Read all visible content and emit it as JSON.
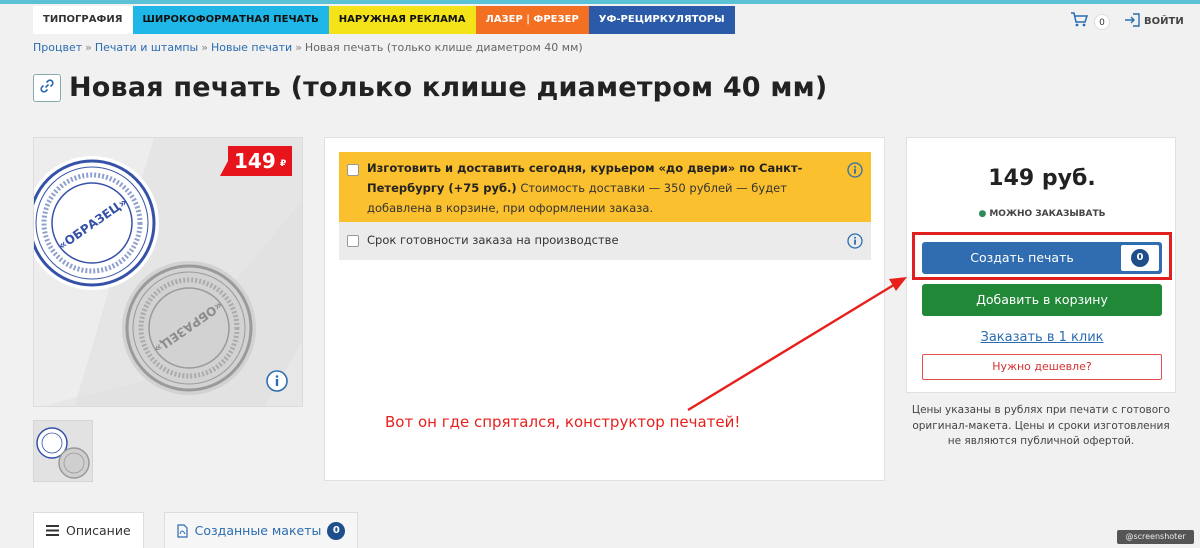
{
  "nav": {
    "tabs": [
      {
        "label": "ТИПОГРАФИЯ",
        "color": "#ffffff"
      },
      {
        "label": "ШИРОКОФОРМАТНАЯ ПЕЧАТЬ",
        "color": "#1fb6e8"
      },
      {
        "label": "НАРУЖНАЯ РЕКЛАМА",
        "color": "#f5e31a"
      },
      {
        "label": "ЛАЗЕР | ФРЕЗЕР",
        "color": "#f36f21"
      },
      {
        "label": "УФ-РЕЦИРКУЛЯТОРЫ",
        "color": "#2a5aa8"
      }
    ],
    "cart_count": "0",
    "login_label": "ВОЙТИ"
  },
  "breadcrumb": {
    "items": [
      "Процвет",
      "Печати и штампы",
      "Новые печати"
    ],
    "separator": "»",
    "current": "Новая печать (только клише диаметром 40 мм)"
  },
  "page": {
    "title": "Новая печать (только клише диаметром 40 мм)"
  },
  "product": {
    "price_badge": "149",
    "currency_symbol": "₽",
    "stamp_text": "«ОБРАЗЕЦ»"
  },
  "options": {
    "delivery": {
      "title_bold": "Изготовить и доставить сегодня, курьером «до двери» по Санкт-Петербургу (+75 руб.)",
      "description": " Стоимость доставки — 350 рублей — будет добавлена в корзине, при оформлении заказа."
    },
    "readiness": {
      "label": "Срок готовности заказа на производстве"
    }
  },
  "annotation": {
    "text": "Вот он где спрятался, конструктор печатей!",
    "color": "#e8201c"
  },
  "buy": {
    "price": "149 руб.",
    "availability": "МОЖНО ЗАКАЗЫВАТЬ",
    "create_button": "Создать печать",
    "create_count": "0",
    "add_to_cart": "Добавить в корзину",
    "one_click": "Заказать в 1 клик",
    "cheaper": "Нужно дешевле?",
    "note": "Цены указаны в рублях при печати с готового оригинал-макета. Цены и сроки изготовления не являются публичной офертой."
  },
  "tabs": {
    "description": "Описание",
    "layouts": "Созданные макеты",
    "layouts_count": "0"
  },
  "watermark": "@screenshoter",
  "colors": {
    "accent_blue": "#2f6db0",
    "green": "#218838",
    "highlight_yellow": "#fbc02d",
    "annotation_red": "#e02020"
  }
}
